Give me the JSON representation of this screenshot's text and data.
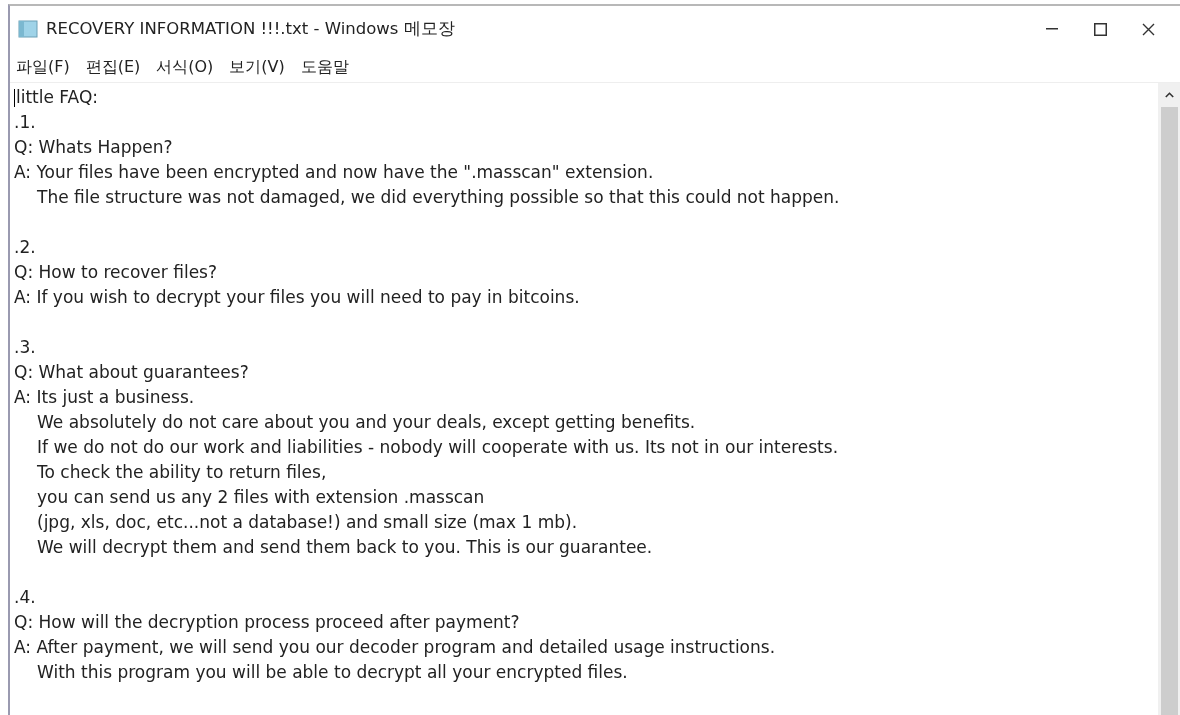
{
  "window": {
    "title": "RECOVERY INFORMATION !!!.txt - Windows 메모장"
  },
  "menu": [
    {
      "label": "파일(F)"
    },
    {
      "label": "편집(E)"
    },
    {
      "label": "서식(O)"
    },
    {
      "label": "보기(V)"
    },
    {
      "label": "도움말"
    }
  ],
  "document": {
    "heading": "little FAQ:",
    "sections": [
      {
        "number": ".1.",
        "question": "Q: Whats Happen?",
        "answer": [
          "A: Your files have been encrypted and now have the \".masscan\" extension.",
          "The file structure was not damaged, we did everything possible so that this could not happen."
        ]
      },
      {
        "number": ".2.",
        "question": "Q: How to recover files?",
        "answer": [
          "A: If you wish to decrypt your files you will need to pay in bitcoins."
        ]
      },
      {
        "number": ".3.",
        "question": "Q: What about guarantees?",
        "answer": [
          "A: Its just a business.",
          "We absolutely do not care about you and your deals, except getting benefits.",
          "If we do not do our work and liabilities - nobody will cooperate with us. Its not in our interests.",
          "To check the ability to return files,",
          "you can send us any 2 files with extension .masscan",
          "(jpg, xls, doc, etc...not a database!) and small size (max 1 mb).",
          "We will decrypt them and send them back to you. This is our guarantee."
        ]
      },
      {
        "number": ".4.",
        "question": "Q: How will the decryption process proceed after payment?",
        "answer": [
          "A: After payment, we will send you our decoder program and detailed usage instructions.",
          "With this program you will be able to decrypt all your encrypted files."
        ]
      }
    ]
  }
}
